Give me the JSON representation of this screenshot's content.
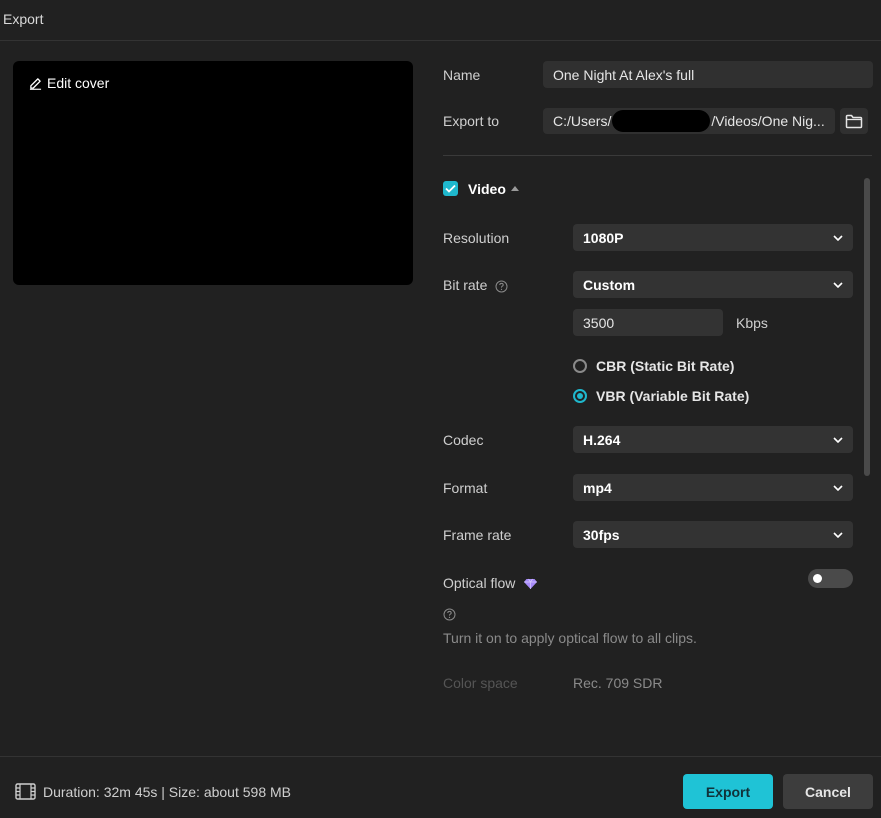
{
  "window": {
    "title": "Export"
  },
  "preview": {
    "edit_cover_label": "Edit cover"
  },
  "name": {
    "label": "Name",
    "value": "One Night At Alex's full"
  },
  "export_to": {
    "label": "Export to",
    "value_start": "C:/Users/",
    "value_end": "/Videos/One Nig..."
  },
  "video": {
    "section_title": "Video",
    "enabled": true,
    "resolution": {
      "label": "Resolution",
      "value": "1080P"
    },
    "bit_rate": {
      "label": "Bit rate",
      "value": "Custom",
      "kbps_value": "3500",
      "unit": "Kbps"
    },
    "rate_modes": [
      {
        "label": "CBR (Static Bit Rate)",
        "selected": false
      },
      {
        "label": "VBR (Variable Bit Rate)",
        "selected": true
      }
    ],
    "codec": {
      "label": "Codec",
      "value": "H.264"
    },
    "format": {
      "label": "Format",
      "value": "mp4"
    },
    "frame_rate": {
      "label": "Frame rate",
      "value": "30fps"
    },
    "optical_flow": {
      "label": "Optical flow",
      "enabled": false,
      "hint": "Turn it on to apply optical flow to all clips."
    },
    "color_space": {
      "label": "Color space",
      "value": "Rec. 709 SDR"
    }
  },
  "footer": {
    "info": "Duration: 32m 45s | Size: about 598 MB",
    "export_label": "Export",
    "cancel_label": "Cancel"
  },
  "colors": {
    "accent": "#1fc3d6",
    "background": "#212121",
    "field": "#333333",
    "premium": "#a78bfa"
  }
}
